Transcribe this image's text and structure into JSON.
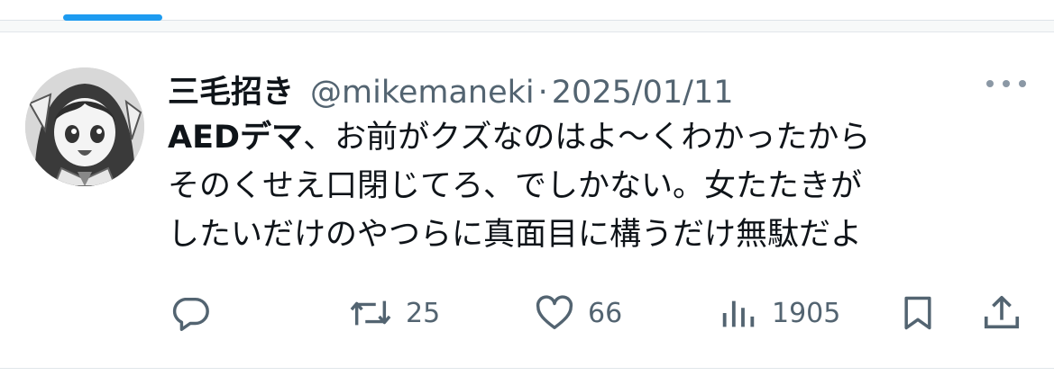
{
  "tweet": {
    "author_name": "三毛招き",
    "handle": "@mikemaneki",
    "separator": "·",
    "date": "2025/01/11",
    "body_bold": "AEDデマ",
    "body_line1_rest": "、お前がクズなのはよ〜くわかったから",
    "body_line2": "そのくせえ口閉じてろ、でしかない。女たたきが",
    "body_line3": "したいだけのやつらに真面目に構うだけ無駄だよ"
  },
  "actions": {
    "reply_icon": "reply-icon",
    "retweet_icon": "retweet-icon",
    "retweet_count": "25",
    "like_icon": "heart-icon",
    "like_count": "66",
    "views_icon": "views-bar-chart-icon",
    "views_count": "1905",
    "bookmark_icon": "bookmark-icon",
    "share_icon": "share-upload-icon"
  },
  "colors": {
    "accent": "#1d9bf0",
    "text_primary": "#0f1419",
    "text_secondary": "#536471"
  }
}
